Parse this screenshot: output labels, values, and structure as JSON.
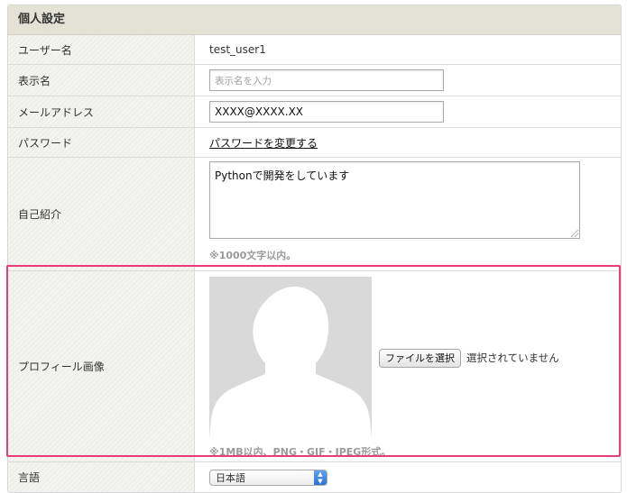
{
  "panel": {
    "title": "個人設定"
  },
  "rows": {
    "username": {
      "label": "ユーザー名",
      "value": "test_user1"
    },
    "display_name": {
      "label": "表示名",
      "placeholder": "表示名を入力",
      "value": ""
    },
    "email": {
      "label": "メールアドレス",
      "value": "XXXX@XXXX.XX"
    },
    "password": {
      "label": "パスワード",
      "link": "パスワードを変更する"
    },
    "bio": {
      "label": "自己紹介",
      "value": "Pythonで開発をしています",
      "note": "※1000文字以内。"
    },
    "profile_image": {
      "label": "プロフィール画像",
      "button": "ファイルを選択",
      "status": "選択されていません",
      "note": "※1MB以内、PNG・GIF・JPEG形式。"
    },
    "language": {
      "label": "言語",
      "selected": "日本語"
    }
  },
  "icons": {
    "avatar": "default-user-silhouette",
    "select_arrow": "updown-chevron-icon"
  },
  "colors": {
    "highlight": "#ea3c7a",
    "header_bg": "#e3e2d5",
    "avatar_bg": "#d9d9d9"
  }
}
